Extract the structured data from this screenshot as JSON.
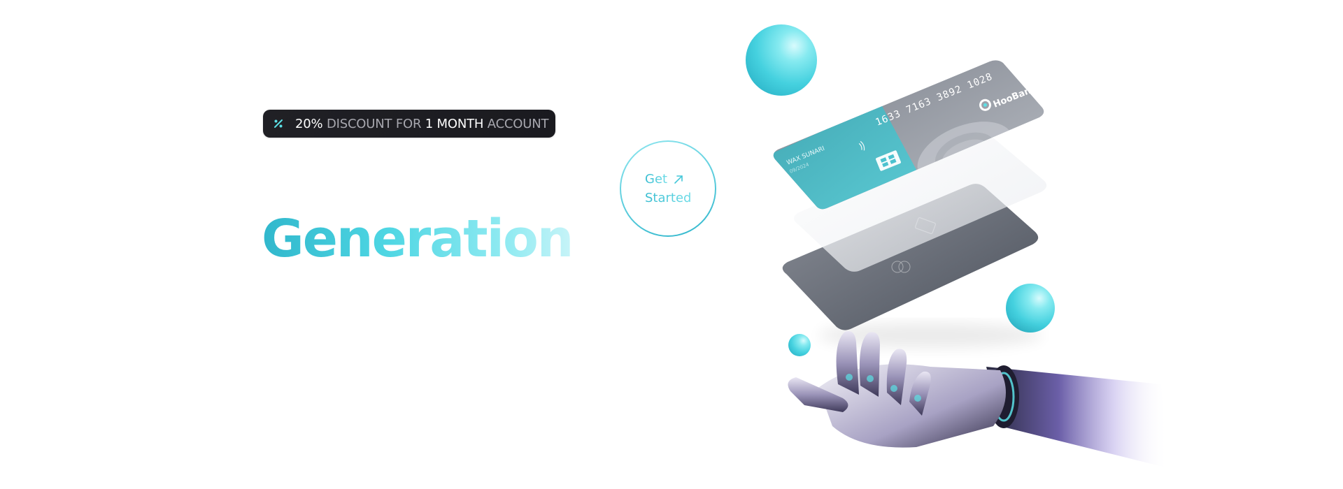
{
  "promo": {
    "percent": "20%",
    "text_1": " DISCOUNT FOR ",
    "duration": "1 MONTH",
    "text_2": " ACCOUNT",
    "icon": "discount-icon"
  },
  "hero": {
    "headline": "Generation"
  },
  "cta": {
    "line_1": "Get",
    "line_2": "Started",
    "icon": "arrow-up-right-icon"
  },
  "card": {
    "number": "1633 7163 3892 1028",
    "brand": "HooBank",
    "holder": "WAX SUNARI",
    "expiry": "09/2024"
  },
  "colors": {
    "accent": "#33BBCF",
    "accent_light": "#5CE1E6",
    "badge_bg": "#1F1F24",
    "badge_text": "#A7A7AE",
    "card_dark": "#5E626C"
  }
}
